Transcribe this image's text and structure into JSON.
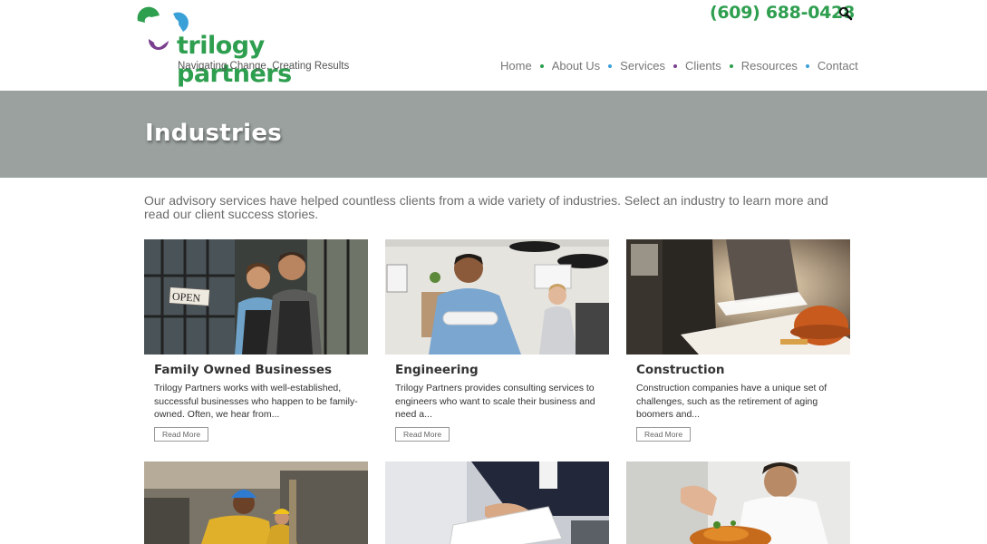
{
  "header": {
    "logo_name": "trilogy partners",
    "logo_tagline": "Navigating Change, Creating Results",
    "phone": "(609) 688-0428",
    "nav": [
      {
        "label": "Home",
        "dot_color": "#2e9e4f"
      },
      {
        "label": "About Us",
        "dot_color": "#3aa0d8"
      },
      {
        "label": "Services",
        "dot_color": "#7b3f8f"
      },
      {
        "label": "Clients",
        "dot_color": "#2e9e4f"
      },
      {
        "label": "Resources",
        "dot_color": "#3aa0d8"
      },
      {
        "label": "Contact",
        "dot_color": ""
      }
    ]
  },
  "banner": {
    "title": "Industries"
  },
  "intro": "Our advisory services have helped countless clients from a wide variety of industries. Select an industry to learn more and read our client success stories.",
  "cards": [
    {
      "title": "Family Owned Businesses",
      "excerpt": "Trilogy Partners works with well-established, successful businesses who happen to be family-owned. Often, we hear from...",
      "read_more": "Read More",
      "sign_text": "OPEN"
    },
    {
      "title": "Engineering",
      "excerpt": "Trilogy Partners provides consulting services to engineers who want to scale their business and need a...",
      "read_more": "Read More"
    },
    {
      "title": "Construction",
      "excerpt": "Construction companies have a unique set of challenges, such as the retirement of aging boomers and...",
      "read_more": "Read More"
    }
  ],
  "colors": {
    "brand_green": "#2e9e4f",
    "brand_blue": "#3aa0d8",
    "brand_purple": "#7b3f8f",
    "banner_gray": "#9aa19e"
  }
}
